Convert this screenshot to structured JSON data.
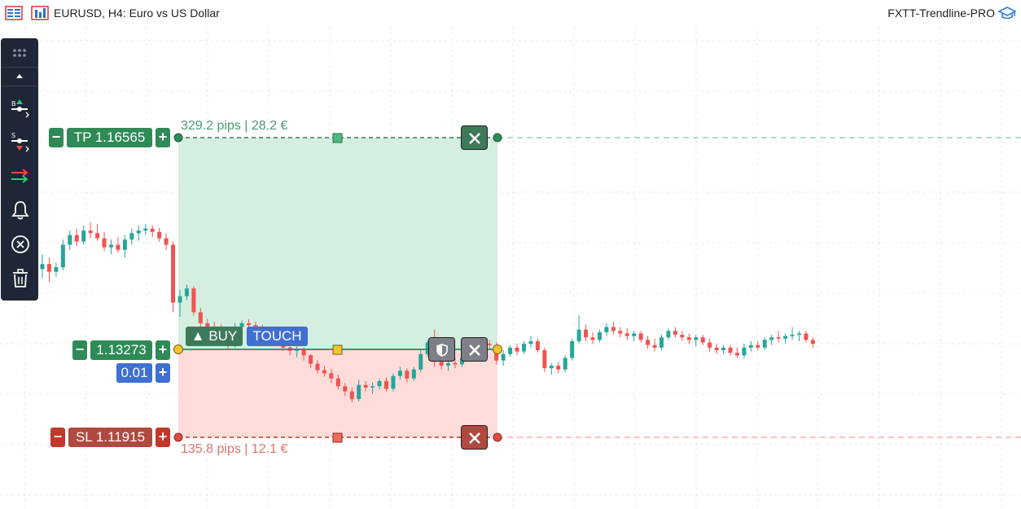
{
  "header": {
    "symbol_title": "EURUSD, H4:  Euro vs US Dollar",
    "indicator_name": "FXTT-Trendline-PRO"
  },
  "toolbar": {
    "items": [
      {
        "name": "drag-handle-icon"
      },
      {
        "name": "collapse-up-icon"
      },
      {
        "name": "buy-line-tool-icon"
      },
      {
        "name": "sell-line-tool-icon"
      },
      {
        "name": "arrows-tool-icon"
      },
      {
        "name": "alert-bell-icon"
      },
      {
        "name": "close-all-icon"
      },
      {
        "name": "delete-all-icon"
      }
    ]
  },
  "order": {
    "tp_label": "TP 1.16565",
    "tp_pips_text": "329.2 pips | 28.2 €",
    "entry_price": "1.13273",
    "direction_label": "▲ BUY",
    "order_type_label": "TOUCH",
    "lot_size": "0.01",
    "sl_label": "SL 1.11915",
    "sl_pips_text": "135.8 pips | 12.1 €",
    "minus_symbol": "−",
    "plus_symbol": "+"
  },
  "colors": {
    "bull": "#26a69a",
    "bear": "#ef5350",
    "tp_zone": "#d4eee0",
    "sl_zone": "#fddcda",
    "tp_line": "#3e7a5a",
    "sl_line": "#c0392b"
  },
  "chart_data": {
    "type": "candlestick",
    "symbol": "EURUSD",
    "timeframe": "H4",
    "price_levels": {
      "take_profit": 1.16565,
      "entry": 1.13273,
      "stop_loss": 1.11915
    },
    "ohlc": [
      [
        1.1452,
        1.1475,
        1.1438,
        1.146
      ],
      [
        1.146,
        1.147,
        1.1432,
        1.1448
      ],
      [
        1.1448,
        1.1462,
        1.144,
        1.1455
      ],
      [
        1.1455,
        1.1498,
        1.145,
        1.149
      ],
      [
        1.149,
        1.1512,
        1.1482,
        1.1505
      ],
      [
        1.1505,
        1.1515,
        1.1488,
        1.1495
      ],
      [
        1.1495,
        1.152,
        1.149,
        1.1512
      ],
      [
        1.1512,
        1.1525,
        1.15,
        1.1508
      ],
      [
        1.1508,
        1.1522,
        1.1496,
        1.15
      ],
      [
        1.15,
        1.151,
        1.148,
        1.1486
      ],
      [
        1.1486,
        1.1498,
        1.1475,
        1.149
      ],
      [
        1.149,
        1.1502,
        1.1478,
        1.1482
      ],
      [
        1.1482,
        1.1505,
        1.147,
        1.1498
      ],
      [
        1.1498,
        1.1515,
        1.149,
        1.1508
      ],
      [
        1.1508,
        1.152,
        1.1496,
        1.1512
      ],
      [
        1.1512,
        1.1522,
        1.1505,
        1.1515
      ],
      [
        1.1515,
        1.152,
        1.1502,
        1.151
      ],
      [
        1.151,
        1.1516,
        1.1495,
        1.15
      ],
      [
        1.15,
        1.1508,
        1.1482,
        1.149
      ],
      [
        1.149,
        1.1495,
        1.1385,
        1.14
      ],
      [
        1.14,
        1.142,
        1.1378,
        1.141
      ],
      [
        1.141,
        1.1428,
        1.1404,
        1.1422
      ],
      [
        1.1422,
        1.1425,
        1.138,
        1.1385
      ],
      [
        1.1385,
        1.1392,
        1.136,
        1.1368
      ],
      [
        1.1368,
        1.1375,
        1.1355,
        1.1362
      ],
      [
        1.1362,
        1.137,
        1.1352,
        1.1358
      ],
      [
        1.1358,
        1.1366,
        1.1348,
        1.1352
      ],
      [
        1.1352,
        1.1356,
        1.1328,
        1.1335
      ],
      [
        1.1335,
        1.1368,
        1.133,
        1.1362
      ],
      [
        1.1362,
        1.1372,
        1.135,
        1.1368
      ],
      [
        1.1368,
        1.1374,
        1.1358,
        1.1365
      ],
      [
        1.1365,
        1.137,
        1.1355,
        1.136
      ],
      [
        1.136,
        1.1366,
        1.1345,
        1.135
      ],
      [
        1.135,
        1.1358,
        1.1338,
        1.1345
      ],
      [
        1.1345,
        1.1356,
        1.1335,
        1.1352
      ],
      [
        1.1352,
        1.1354,
        1.1325,
        1.133
      ],
      [
        1.133,
        1.1335,
        1.1318,
        1.1325
      ],
      [
        1.1325,
        1.1332,
        1.1315,
        1.1328
      ],
      [
        1.1328,
        1.133,
        1.131,
        1.1318
      ],
      [
        1.1318,
        1.132,
        1.1298,
        1.1305
      ],
      [
        1.1305,
        1.131,
        1.129,
        1.1295
      ],
      [
        1.1295,
        1.1302,
        1.1285,
        1.129
      ],
      [
        1.129,
        1.1296,
        1.1275,
        1.1282
      ],
      [
        1.1282,
        1.1288,
        1.1265,
        1.127
      ],
      [
        1.127,
        1.1275,
        1.1255,
        1.1262
      ],
      [
        1.1262,
        1.1268,
        1.1245,
        1.125
      ],
      [
        1.125,
        1.128,
        1.1246,
        1.1272
      ],
      [
        1.1272,
        1.1278,
        1.1262,
        1.1268
      ],
      [
        1.1268,
        1.1276,
        1.1258,
        1.127
      ],
      [
        1.127,
        1.1282,
        1.1265,
        1.1278
      ],
      [
        1.1278,
        1.1284,
        1.1262,
        1.1266
      ],
      [
        1.1266,
        1.129,
        1.1262,
        1.1286
      ],
      [
        1.1286,
        1.13,
        1.128,
        1.1294
      ],
      [
        1.1294,
        1.1298,
        1.1276,
        1.1282
      ],
      [
        1.1282,
        1.13,
        1.1278,
        1.1296
      ],
      [
        1.1296,
        1.1328,
        1.1292,
        1.132
      ],
      [
        1.132,
        1.1342,
        1.1316,
        1.1338
      ],
      [
        1.1338,
        1.1358,
        1.13,
        1.1308
      ],
      [
        1.1308,
        1.1316,
        1.1296,
        1.1302
      ],
      [
        1.1302,
        1.131,
        1.1294,
        1.1306
      ],
      [
        1.1306,
        1.1314,
        1.1298,
        1.1304
      ],
      [
        1.1304,
        1.1318,
        1.13,
        1.1314
      ],
      [
        1.1314,
        1.1332,
        1.131,
        1.1328
      ],
      [
        1.1328,
        1.1344,
        1.1324,
        1.134
      ],
      [
        1.134,
        1.1346,
        1.133,
        1.1336
      ],
      [
        1.1336,
        1.1342,
        1.1328,
        1.1334
      ],
      [
        1.1334,
        1.1338,
        1.1304,
        1.131
      ],
      [
        1.131,
        1.1326,
        1.1302,
        1.132
      ],
      [
        1.132,
        1.1334,
        1.1316,
        1.133
      ],
      [
        1.133,
        1.1336,
        1.1318,
        1.1324
      ],
      [
        1.1324,
        1.134,
        1.132,
        1.1336
      ],
      [
        1.1336,
        1.1348,
        1.133,
        1.134
      ],
      [
        1.134,
        1.1344,
        1.1322,
        1.1326
      ],
      [
        1.1326,
        1.133,
        1.1292,
        1.1298
      ],
      [
        1.1298,
        1.1306,
        1.1288,
        1.1302
      ],
      [
        1.1302,
        1.1308,
        1.129,
        1.1296
      ],
      [
        1.1296,
        1.1318,
        1.1292,
        1.1314
      ],
      [
        1.1314,
        1.1344,
        1.131,
        1.134
      ],
      [
        1.134,
        1.138,
        1.1336,
        1.1358
      ],
      [
        1.1358,
        1.1366,
        1.134,
        1.1346
      ],
      [
        1.1346,
        1.1354,
        1.1336,
        1.1342
      ],
      [
        1.1342,
        1.1358,
        1.1338,
        1.1354
      ],
      [
        1.1354,
        1.1368,
        1.1348,
        1.1362
      ],
      [
        1.1362,
        1.137,
        1.135,
        1.1356
      ],
      [
        1.1356,
        1.1362,
        1.1346,
        1.1352
      ],
      [
        1.1352,
        1.136,
        1.1342,
        1.1348
      ],
      [
        1.1348,
        1.1356,
        1.134,
        1.1352
      ],
      [
        1.1352,
        1.1356,
        1.1338,
        1.1342
      ],
      [
        1.1342,
        1.1348,
        1.1328,
        1.1334
      ],
      [
        1.1334,
        1.1344,
        1.1324,
        1.133
      ],
      [
        1.133,
        1.135,
        1.1326,
        1.1346
      ],
      [
        1.1346,
        1.136,
        1.1342,
        1.1356
      ],
      [
        1.1356,
        1.1362,
        1.1346,
        1.135
      ],
      [
        1.135,
        1.1356,
        1.134,
        1.1346
      ],
      [
        1.1346,
        1.1352,
        1.1336,
        1.1342
      ],
      [
        1.1342,
        1.135,
        1.1332,
        1.1346
      ],
      [
        1.1346,
        1.135,
        1.1334,
        1.1338
      ],
      [
        1.1338,
        1.1344,
        1.1324,
        1.133
      ],
      [
        1.133,
        1.1336,
        1.132,
        1.1326
      ],
      [
        1.1326,
        1.1334,
        1.132,
        1.133
      ],
      [
        1.133,
        1.1334,
        1.1318,
        1.1322
      ],
      [
        1.1322,
        1.133,
        1.1314,
        1.1318
      ],
      [
        1.1318,
        1.1336,
        1.1314,
        1.133
      ],
      [
        1.133,
        1.134,
        1.1324,
        1.1334
      ],
      [
        1.1334,
        1.134,
        1.1326,
        1.133
      ],
      [
        1.133,
        1.1346,
        1.1326,
        1.1342
      ],
      [
        1.1342,
        1.135,
        1.1334,
        1.1346
      ],
      [
        1.1346,
        1.1356,
        1.1338,
        1.1344
      ],
      [
        1.1344,
        1.1352,
        1.1336,
        1.1348
      ],
      [
        1.1348,
        1.1362,
        1.1342,
        1.135
      ],
      [
        1.135,
        1.1356,
        1.134,
        1.1352
      ],
      [
        1.1352,
        1.1356,
        1.1338,
        1.1342
      ],
      [
        1.1342,
        1.1346,
        1.133,
        1.1336
      ]
    ]
  }
}
